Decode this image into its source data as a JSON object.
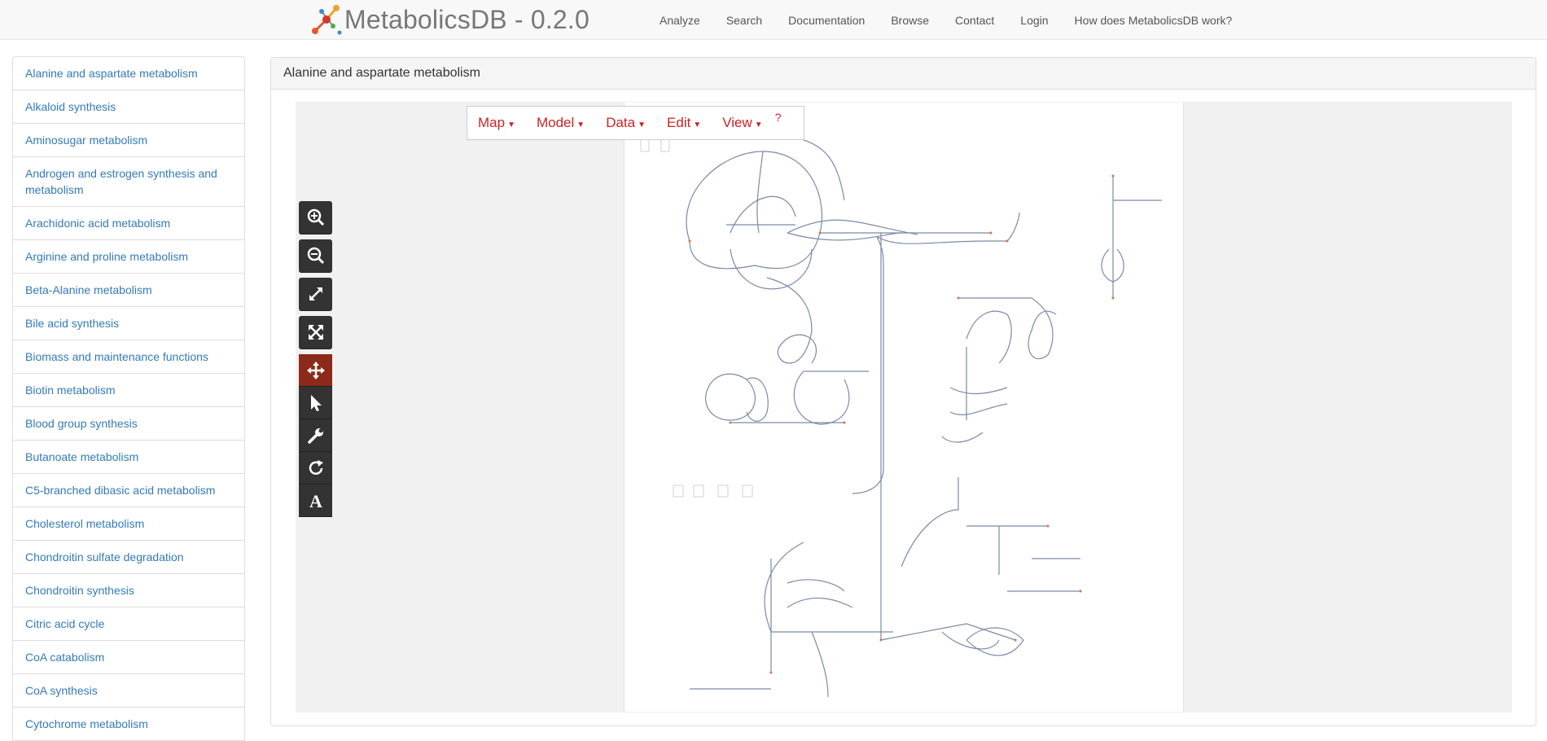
{
  "brand": {
    "name": "MetabolicsDB - 0.2.0",
    "logo_icon": "molecule-logo-icon"
  },
  "nav": [
    "Analyze",
    "Search",
    "Documentation",
    "Browse",
    "Contact",
    "Login",
    "How does MetabolicsDB work?"
  ],
  "sidebar": {
    "items": [
      "Alanine and aspartate metabolism",
      "Alkaloid synthesis",
      "Aminosugar metabolism",
      "Androgen and estrogen synthesis and metabolism",
      "Arachidonic acid metabolism",
      "Arginine and proline metabolism",
      "Beta-Alanine metabolism",
      "Bile acid synthesis",
      "Biomass and maintenance functions",
      "Biotin metabolism",
      "Blood group synthesis",
      "Butanoate metabolism",
      "C5-branched dibasic acid metabolism",
      "Cholesterol metabolism",
      "Chondroitin sulfate degradation",
      "Chondroitin synthesis",
      "Citric acid cycle",
      "CoA catabolism",
      "CoA synthesis",
      "Cytochrome metabolism"
    ]
  },
  "panel": {
    "title": "Alanine and aspartate metabolism"
  },
  "map_menu": {
    "items": [
      "Map",
      "Model",
      "Data",
      "Edit",
      "View"
    ],
    "help": "?",
    "color": "#cc2222"
  },
  "toolbar": {
    "icons": [
      "zoom-in-icon",
      "zoom-out-icon",
      "zoom-fit-icon",
      "zoom-full-icon",
      "pan-icon",
      "select-icon",
      "wrench-icon",
      "rotate-icon",
      "text-icon"
    ],
    "active": "pan-icon"
  }
}
